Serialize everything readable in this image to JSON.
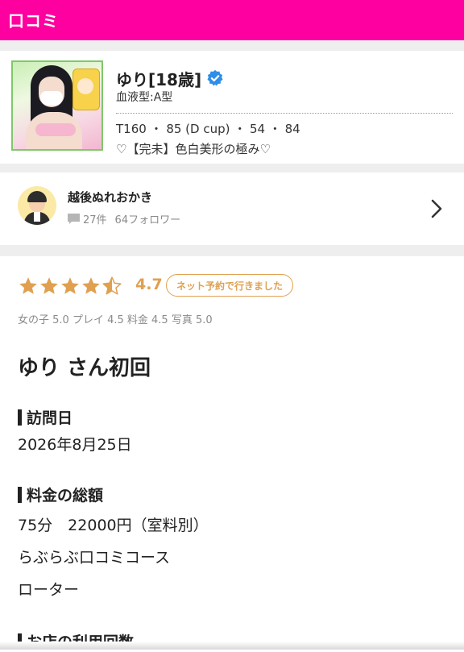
{
  "header": {
    "title": "口コミ",
    "bg_color": "#ff00a0"
  },
  "profile": {
    "name": "ゆり[18歳]",
    "verified_icon": "verified-badge-icon",
    "blood_type": "血液型:A型",
    "stats": "T160 ・ 85 (D cup) ・ 54 ・ 84",
    "catchphrase": "♡【完未】色白美形の極み♡"
  },
  "reviewer": {
    "name": "越後ぬれおかき",
    "reviews": "27件",
    "followers": "64フォロワー"
  },
  "review": {
    "stars": 4.5,
    "score": "4.7",
    "booking_badge": "ネット予約で行きました",
    "subscores": "女の子 5.0 プレイ 4.5 料金 4.5 写真 5.0",
    "title": "ゆり さん初回",
    "visit_label": "訪問日",
    "visit_date": "2026年8月25日",
    "fee_label": "料金の総額",
    "fee_lines": [
      "75分　22000円（室料別）",
      "らぶらぶ口コミコース",
      "ローター"
    ],
    "usage_label": "お店の利用回数"
  },
  "colors": {
    "accent": "#ff00a0",
    "gold": "#e0a050",
    "verified": "#2f8ee8"
  }
}
